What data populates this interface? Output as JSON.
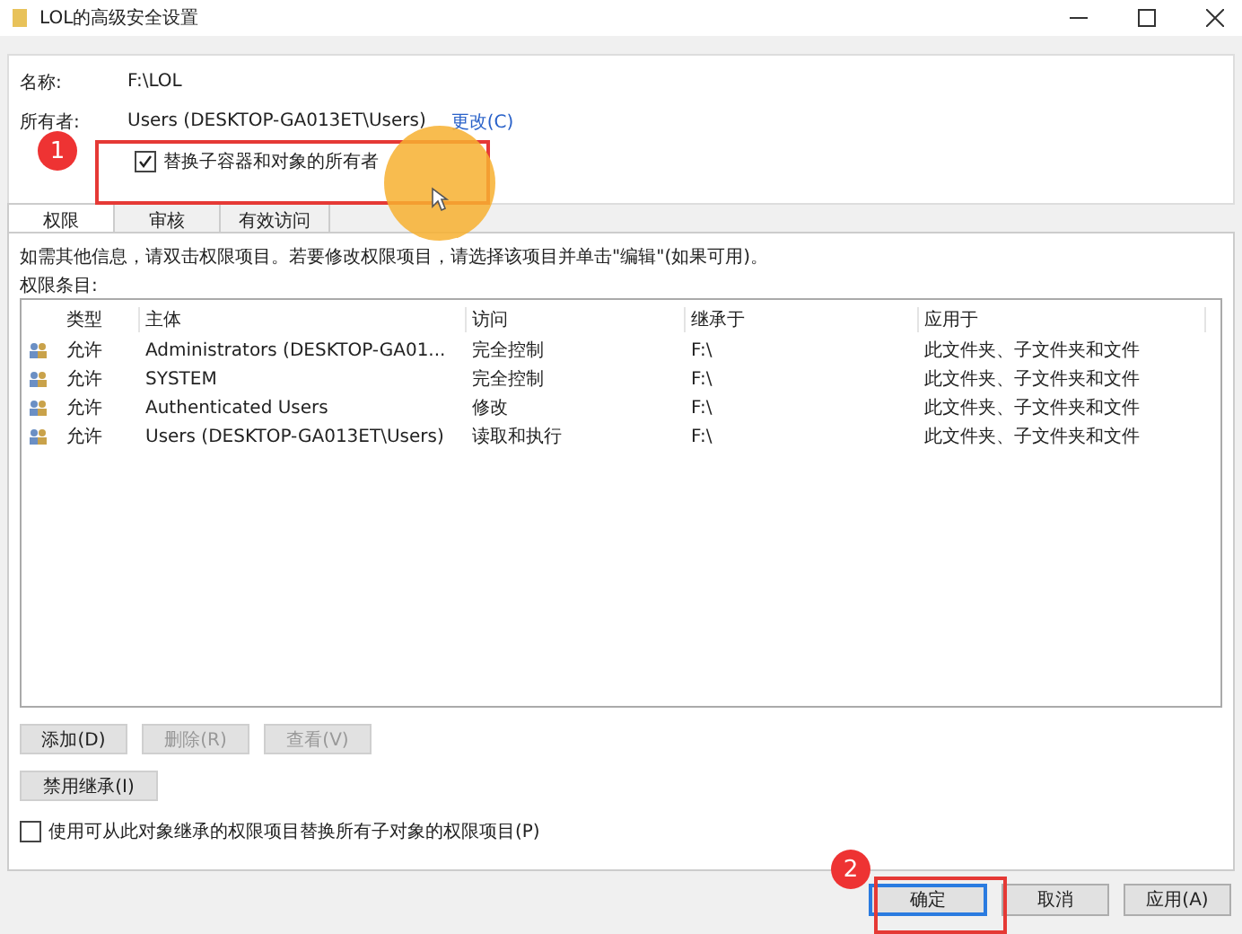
{
  "window": {
    "title": "LOL的高级安全设置"
  },
  "name": {
    "label": "名称:",
    "value": "F:\\LOL"
  },
  "owner": {
    "label": "所有者:",
    "value": "Users (DESKTOP-GA013ET\\Users)",
    "link": "更改(C)"
  },
  "replace_owner": {
    "label": "替换子容器和对象的所有者",
    "checked": true
  },
  "tabs": [
    {
      "label": "权限",
      "selected": true
    },
    {
      "label": "审核",
      "selected": false
    },
    {
      "label": "有效访问",
      "selected": false
    }
  ],
  "info": "如需其他信息，请双击权限项目。若要修改权限项目，请选择该项目并单击\"编辑\"(如果可用)。",
  "entries_label": "权限条目:",
  "table": {
    "columns": [
      "类型",
      "主体",
      "访问",
      "继承于",
      "应用于"
    ],
    "rows": [
      {
        "cells": [
          "允许",
          "Administrators (DESKTOP-GA01...",
          "完全控制",
          "F:\\",
          "此文件夹、子文件夹和文件"
        ]
      },
      {
        "cells": [
          "允许",
          "SYSTEM",
          "完全控制",
          "F:\\",
          "此文件夹、子文件夹和文件"
        ]
      },
      {
        "cells": [
          "允许",
          "Authenticated Users",
          "修改",
          "F:\\",
          "此文件夹、子文件夹和文件"
        ]
      },
      {
        "cells": [
          "允许",
          "Users (DESKTOP-GA013ET\\Users)",
          "读取和执行",
          "F:\\",
          "此文件夹、子文件夹和文件"
        ]
      }
    ]
  },
  "entry_buttons": [
    {
      "label": "添加(D)",
      "disabled": false
    },
    {
      "label": "删除(R)",
      "disabled": true
    },
    {
      "label": "查看(V)",
      "disabled": true
    }
  ],
  "inheritance_button": "禁用继承(I)",
  "replace_child": {
    "label": "使用可从此对象继承的权限项目替换所有子对象的权限项目(P)",
    "checked": false
  },
  "footer_buttons": [
    {
      "label": "确定",
      "selected": true
    },
    {
      "label": "取消",
      "selected": false
    },
    {
      "label": "应用(A)",
      "selected": false
    }
  ],
  "annotations": [
    {
      "label": "1"
    },
    {
      "label": "2"
    }
  ]
}
